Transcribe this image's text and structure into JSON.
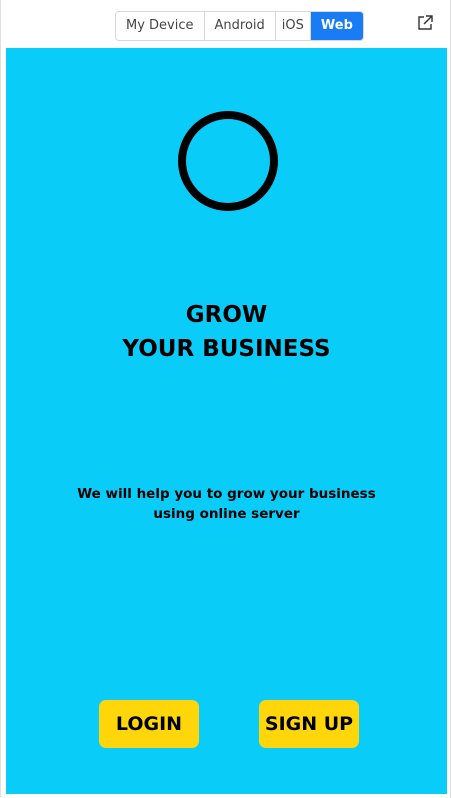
{
  "toolbar": {
    "tabs": [
      {
        "label": "My Device",
        "active": false
      },
      {
        "label": "Android",
        "active": false
      },
      {
        "label": "iOS",
        "active": false
      },
      {
        "label": "Web",
        "active": true
      }
    ],
    "open_external_icon": "external-link-icon"
  },
  "app": {
    "background": "#0accf8",
    "logo_icon": "ring-logo-icon",
    "headline_line1": "GROW",
    "headline_line2": "YOUR BUSINESS",
    "subtext": "We will help you to grow your business using online server",
    "login_label": "LOGIN",
    "signup_label": "SIGN UP",
    "button_color": "#ffd60a"
  },
  "colors": {
    "accent": "#1a7cf5"
  }
}
